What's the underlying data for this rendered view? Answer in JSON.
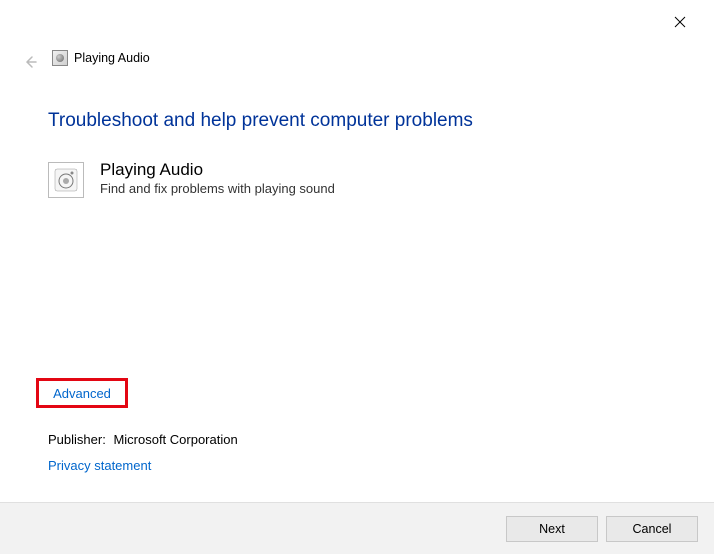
{
  "window": {
    "title": "Playing Audio"
  },
  "main": {
    "heading": "Troubleshoot and help prevent computer problems",
    "item_title": "Playing Audio",
    "item_desc": "Find and fix problems with playing sound"
  },
  "links": {
    "advanced": "Advanced",
    "privacy": "Privacy statement"
  },
  "publisher": {
    "label": "Publisher:",
    "value": "Microsoft Corporation"
  },
  "footer": {
    "next": "Next",
    "cancel": "Cancel"
  }
}
